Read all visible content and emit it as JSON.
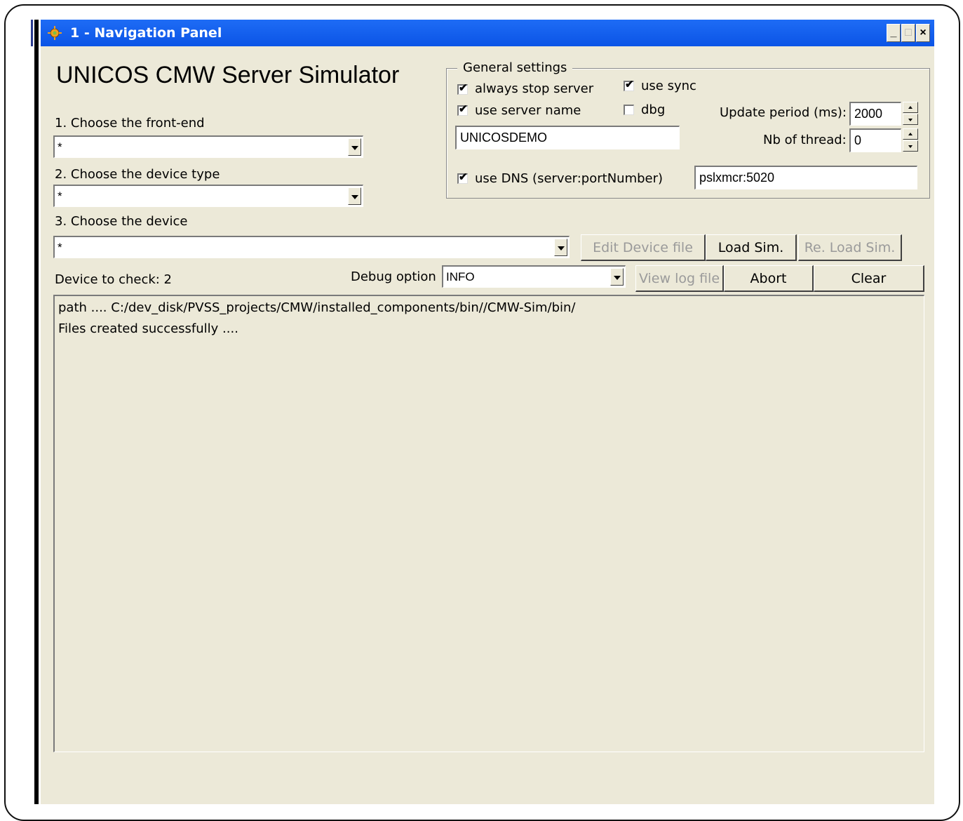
{
  "window": {
    "title": "1 - Navigation Panel",
    "minimize": "_",
    "maximize": "□",
    "close": "×"
  },
  "app_title": "UNICOS CMW Server Simulator",
  "steps": {
    "front_end_label": "1. Choose the front-end",
    "front_end_value": "*",
    "device_type_label": "2. Choose the device type",
    "device_type_value": "*",
    "device_label": "3. Choose the device",
    "device_value": "*"
  },
  "buttons": {
    "edit_device_file": "Edit Device file",
    "load_sim": "Load Sim.",
    "reload_sim": "Re. Load Sim.",
    "view_log_file": "View log file",
    "abort": "Abort",
    "clear": "Clear"
  },
  "device_to_check": "Device to check: 2",
  "debug": {
    "label": "Debug option",
    "value": "INFO"
  },
  "general_settings": {
    "legend": "General settings",
    "always_stop_server": {
      "label": "always stop server",
      "checked": "✔"
    },
    "use_server_name": {
      "label": "use server name",
      "checked": "✔"
    },
    "use_sync": {
      "label": "use sync",
      "checked": "✔"
    },
    "dbg": {
      "label": "dbg",
      "checked": ""
    },
    "server_name_value": "UNICOSDEMO",
    "update_period_label": "Update period (ms):",
    "update_period_value": "2000",
    "nb_thread_label": "Nb of thread:",
    "nb_thread_value": "0",
    "use_dns": {
      "label": "use DNS (server:portNumber)",
      "checked": "✔"
    },
    "dns_value": "pslxmcr:5020"
  },
  "log": {
    "lines": [
      "path .... C:/dev_disk/PVSS_projects/CMW/installed_components/bin//CMW-Sim/bin/",
      "Files created successfully ...."
    ]
  }
}
